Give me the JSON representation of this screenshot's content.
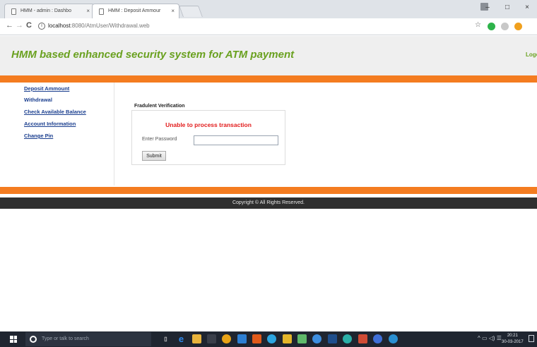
{
  "browser": {
    "tabs": [
      {
        "label": "HMM - admin : Dashbo"
      },
      {
        "label": "HMM : Deposit Ammour"
      }
    ],
    "close_glyph": "×",
    "url_host": "localhost",
    "url_path": ":8080/AtmUser/Withdrawal.web",
    "nav": {
      "back": "←",
      "forward": "→",
      "reload": "C",
      "info": "i"
    },
    "window_controls": {
      "minimize": "–",
      "maximize": "□",
      "close": "×"
    },
    "star": "☆"
  },
  "page": {
    "site_title": "HMM based enhanced security system for ATM payment",
    "logout_label": "Logout",
    "sidebar": [
      {
        "label": "Deposit Ammount"
      },
      {
        "label": "Withdrawal"
      },
      {
        "label": "Check Available Balance"
      },
      {
        "label": "Account Information"
      },
      {
        "label": "Change Pin"
      }
    ],
    "form": {
      "title": "Fradulent Verification",
      "error": "Unable to process transaction",
      "password_label": "Enter Password",
      "password_value": "",
      "submit_label": "Submit"
    },
    "footer": "Copyright © All Rights Reserved."
  },
  "taskbar": {
    "search_placeholder": "Type or talk to search",
    "clock_time": "20:21",
    "clock_date": "30-03-2017",
    "tray_glyphs": "^ ▭ ◁) ☰"
  },
  "colors": {
    "title_green": "#6aa120",
    "orange": "#f47c20",
    "link_blue": "#1b3f8f",
    "error_red": "#e21b1b",
    "footer_dark": "#2f2f2f"
  }
}
